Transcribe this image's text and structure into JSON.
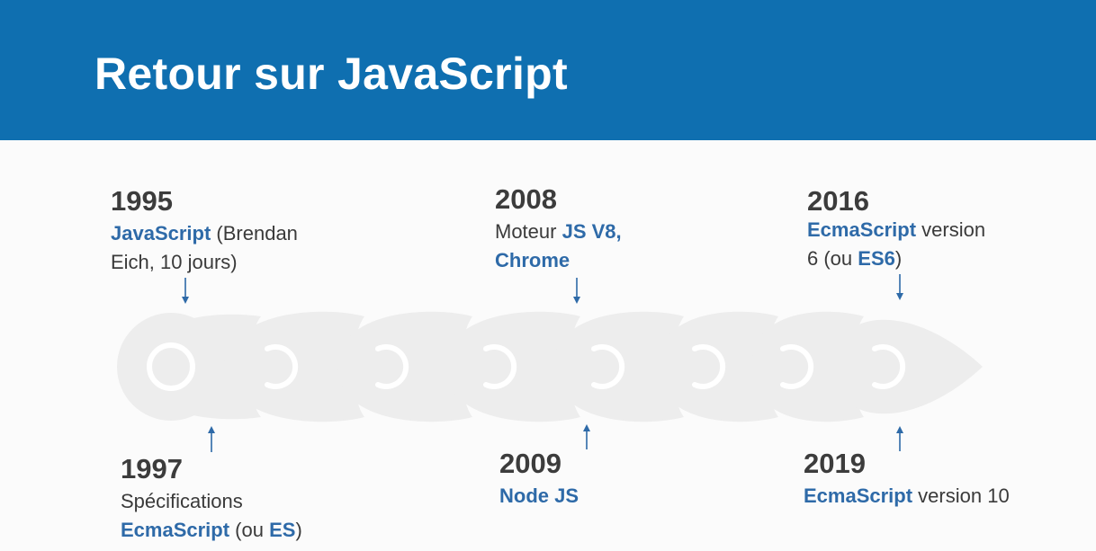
{
  "slide": {
    "title": "Retour sur JavaScript"
  },
  "colors": {
    "header": "#0f6fb0",
    "highlight": "#2e6aa8",
    "text": "#3a3a3a",
    "timeline": "#ededed",
    "arrow": "#2e6aa8"
  },
  "events": {
    "e1995": {
      "year": "1995",
      "l1_hl": "JavaScript",
      "l1_rest": " (Brendan",
      "l2": "Eich, 10 jours)"
    },
    "e1997": {
      "year": "1997",
      "l1": "Spécifications",
      "l2_hl": "EcmaScript",
      "l2_mid": " (ou ",
      "l2_hl2": "ES",
      "l2_end": ")"
    },
    "e2008": {
      "year": "2008",
      "l1_pre": "Moteur ",
      "l1_hl": "JS V8,",
      "l2_hl": "Chrome"
    },
    "e2009": {
      "year": "2009",
      "l1_hl": "Node JS"
    },
    "e2016": {
      "year": "2016",
      "l1_hl": "EcmaScript",
      "l1_rest": " version",
      "l2_pre": "6 (ou ",
      "l2_hl": "ES6",
      "l2_end": ")"
    },
    "e2019": {
      "year": "2019",
      "l1_hl": "EcmaScript",
      "l1_rest": " version 10"
    }
  }
}
